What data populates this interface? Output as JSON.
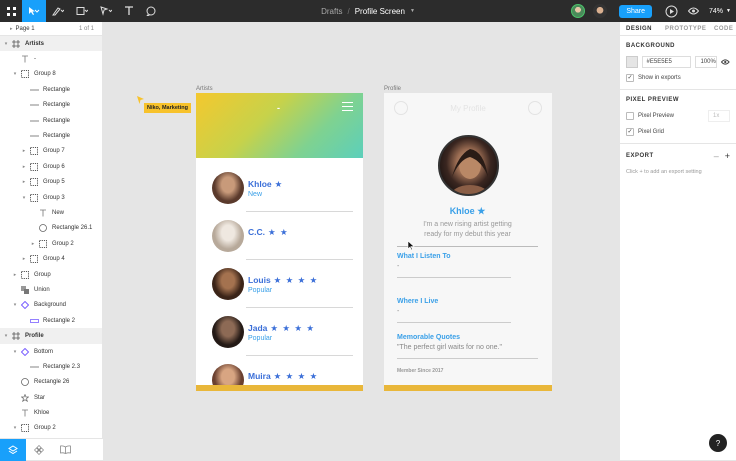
{
  "topbar": {
    "crumb": "Drafts",
    "file": "Profile Screen",
    "share": "Share",
    "zoom": "74%"
  },
  "pages": {
    "current": "Page 1",
    "count": "1 of 1"
  },
  "layers": [
    {
      "name": "Artists",
      "indent": 0,
      "type": "frame",
      "caret": "open",
      "sel": true
    },
    {
      "name": "-",
      "indent": 1,
      "type": "text",
      "caret": ""
    },
    {
      "name": "Group 8",
      "indent": 1,
      "type": "group",
      "caret": "open"
    },
    {
      "name": "Rectangle",
      "indent": 2,
      "type": "line",
      "caret": ""
    },
    {
      "name": "Rectangle",
      "indent": 2,
      "type": "line",
      "caret": ""
    },
    {
      "name": "Rectangle",
      "indent": 2,
      "type": "line",
      "caret": ""
    },
    {
      "name": "Rectangle",
      "indent": 2,
      "type": "line",
      "caret": ""
    },
    {
      "name": "Group 7",
      "indent": 2,
      "type": "group",
      "caret": "closed"
    },
    {
      "name": "Group 6",
      "indent": 2,
      "type": "group",
      "caret": "closed"
    },
    {
      "name": "Group 5",
      "indent": 2,
      "type": "group",
      "caret": "closed"
    },
    {
      "name": "Group 3",
      "indent": 2,
      "type": "group",
      "caret": "open"
    },
    {
      "name": "New",
      "indent": 3,
      "type": "text",
      "caret": ""
    },
    {
      "name": "Rectangle 26.1",
      "indent": 3,
      "type": "circle",
      "caret": ""
    },
    {
      "name": "Group 2",
      "indent": 3,
      "type": "group",
      "caret": "closed"
    },
    {
      "name": "Group 4",
      "indent": 2,
      "type": "group",
      "caret": "closed"
    },
    {
      "name": "Group",
      "indent": 1,
      "type": "group",
      "caret": "closed"
    },
    {
      "name": "Union",
      "indent": 1,
      "type": "union",
      "caret": ""
    },
    {
      "name": "Background",
      "indent": 1,
      "type": "component",
      "caret": "open"
    },
    {
      "name": "Rectangle 2",
      "indent": 2,
      "type": "rect",
      "caret": ""
    },
    {
      "name": "Profile",
      "indent": 0,
      "type": "frame",
      "caret": "open",
      "sel": true
    },
    {
      "name": "Bottom",
      "indent": 1,
      "type": "component",
      "caret": "open"
    },
    {
      "name": "Rectangle 2.3",
      "indent": 2,
      "type": "line",
      "caret": ""
    },
    {
      "name": "Rectangle 26",
      "indent": 1,
      "type": "circle",
      "caret": ""
    },
    {
      "name": "Star",
      "indent": 1,
      "type": "star",
      "caret": ""
    },
    {
      "name": "Khloe",
      "indent": 1,
      "type": "text",
      "caret": ""
    },
    {
      "name": "Group 2",
      "indent": 1,
      "type": "group",
      "caret": "open"
    }
  ],
  "panel": {
    "tabs": [
      "DESIGN",
      "PROTOTYPE",
      "CODE"
    ],
    "background_title": "BACKGROUND",
    "bg_hex": "#E5E5E5",
    "bg_opacity": "100%",
    "show_exports": "Show in exports",
    "pixel_preview_title": "PIXEL PREVIEW",
    "pixel_preview": "Pixel Preview",
    "pixel_preview_scale": "1x",
    "pixel_grid": "Pixel Grid",
    "export_title": "EXPORT",
    "export_hint": "Click + to add an export setting"
  },
  "canvas": {
    "frame_artists": "Artists",
    "frame_profile": "Profile",
    "cursor_label": "Niko, Marketing",
    "header_dash": "-"
  },
  "artists": [
    {
      "name": "Khloe",
      "stars": "★",
      "tag": "New",
      "colors": [
        "#5a3a2c",
        "#c89a7a"
      ]
    },
    {
      "name": "C.C.",
      "stars": "★ ★",
      "tag": "",
      "colors": [
        "#b7a99a",
        "#efe8e0"
      ]
    },
    {
      "name": "Louis",
      "stars": "★ ★ ★ ★",
      "tag": "Popular",
      "colors": [
        "#3b2418",
        "#a4724f"
      ]
    },
    {
      "name": "Jada",
      "stars": "★ ★ ★ ★",
      "tag": "Popular",
      "colors": [
        "#241a16",
        "#8d6a55"
      ]
    },
    {
      "name": "Muira",
      "stars": "★ ★ ★ ★",
      "tag": "",
      "colors": [
        "#6a4030",
        "#d8a582"
      ]
    }
  ],
  "profile": {
    "header_title": "My Profile",
    "name": "Khloe",
    "star": "★",
    "bio_line1": "I'm a new rising artist getting",
    "bio_line2": "ready for my debut this year",
    "fields": [
      {
        "title": "What I Listen To",
        "value": "-"
      },
      {
        "title": "Where I Live",
        "value": "-"
      },
      {
        "title": "Memorable Quotes",
        "value": "\"The perfect girl waits for no one.\""
      }
    ],
    "member_since": "Member Since 2017"
  },
  "colors": {
    "accent": "#18a0fb",
    "gold": "#e9b73a",
    "link": "#3b6fd8"
  }
}
